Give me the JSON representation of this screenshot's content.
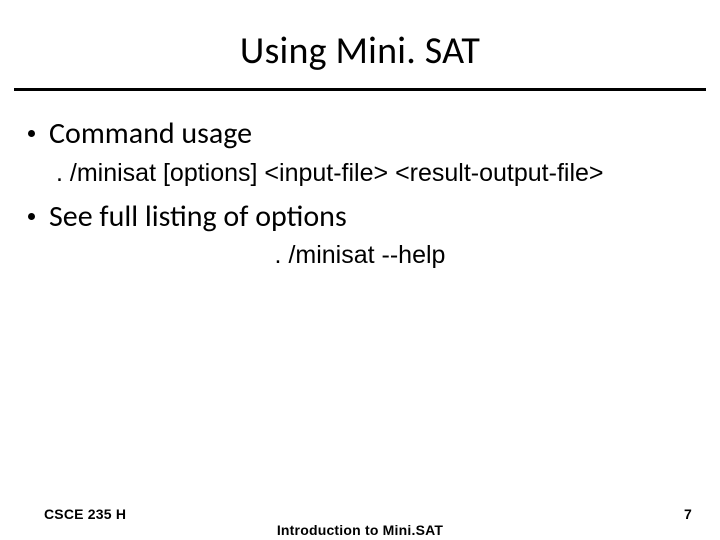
{
  "title": "Using Mini. SAT",
  "bullets": [
    "Command usage",
    "See full listing of options"
  ],
  "code_lines": [
    ". /minisat [options] <input-file> <result-output-file>",
    ". /minisat --help"
  ],
  "footer": {
    "left": "CSCE 235 H",
    "center": "Introduction to Mini.SAT",
    "page": "7"
  }
}
